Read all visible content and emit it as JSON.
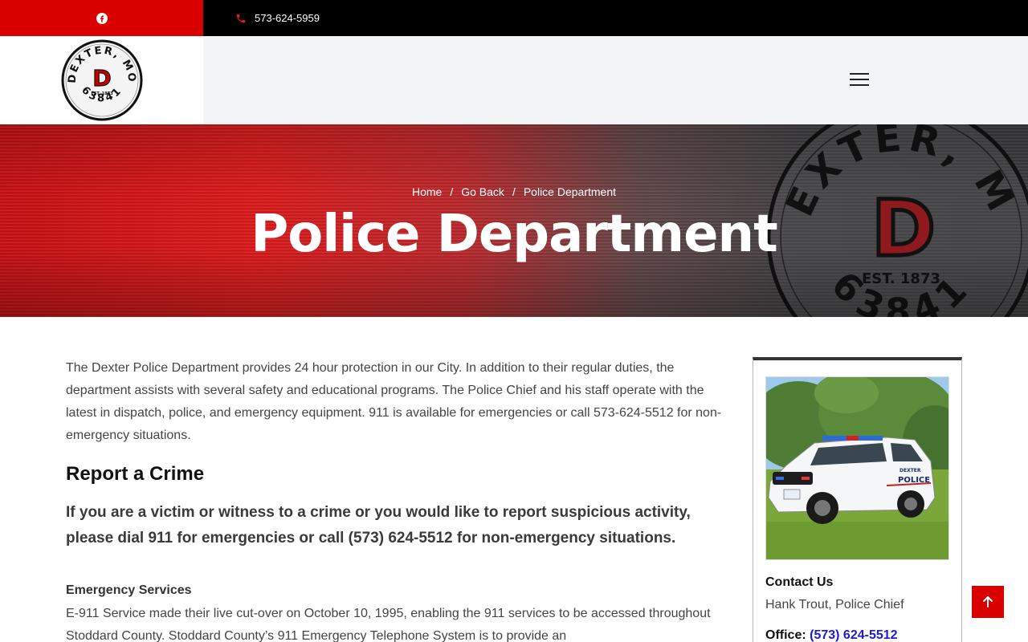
{
  "topbar": {
    "phone": "573-624-5959",
    "social_icon": "facebook-icon",
    "phone_icon": "phone-icon"
  },
  "header": {
    "logo": {
      "city": "DEXTER, MO",
      "letter": "D",
      "est": "EST. 1873",
      "zip": "63841"
    },
    "menu_icon": "hamburger-menu-icon"
  },
  "hero": {
    "breadcrumb": [
      "Home",
      "Go Back",
      "Police Department"
    ],
    "title": "Police Department"
  },
  "main": {
    "intro": "The Dexter Police Department provides 24 hour protection in our City. In addition to their regular duties, the department assists with several safety and educational programs. The Police Chief and his staff operate with the latest in dispatch, police, and emergency equipment. 911 is available for emergencies or call 573-624-5512 for non-emergency situations.",
    "report_heading": "Report a Crime",
    "report_lead": "If you are a victim or witness to a crime or you would like to report suspicious activity, please dial 911 for emergencies or call (573) 624-5512 for non-emergency situations.",
    "emergency_heading": "Emergency Services",
    "emergency_body": "E-911 Service made their live cut-over on October 10, 1995, enabling the 911 services to be accessed throughout Stoddard County. Stoddard County’s 911 Emergency Telephone System is to provide an"
  },
  "sidebar": {
    "contact_title": "Contact Us",
    "contact_name": "Hank Trout, Police Chief",
    "office_label": "Office:",
    "office_phone": "(573) 624-5512",
    "photo_text": [
      "DEXTER",
      "POLICE"
    ]
  },
  "colors": {
    "brand_red": "#d90000",
    "link_blue": "#1a1adb"
  },
  "back_to_top_icon": "arrow-up-icon"
}
